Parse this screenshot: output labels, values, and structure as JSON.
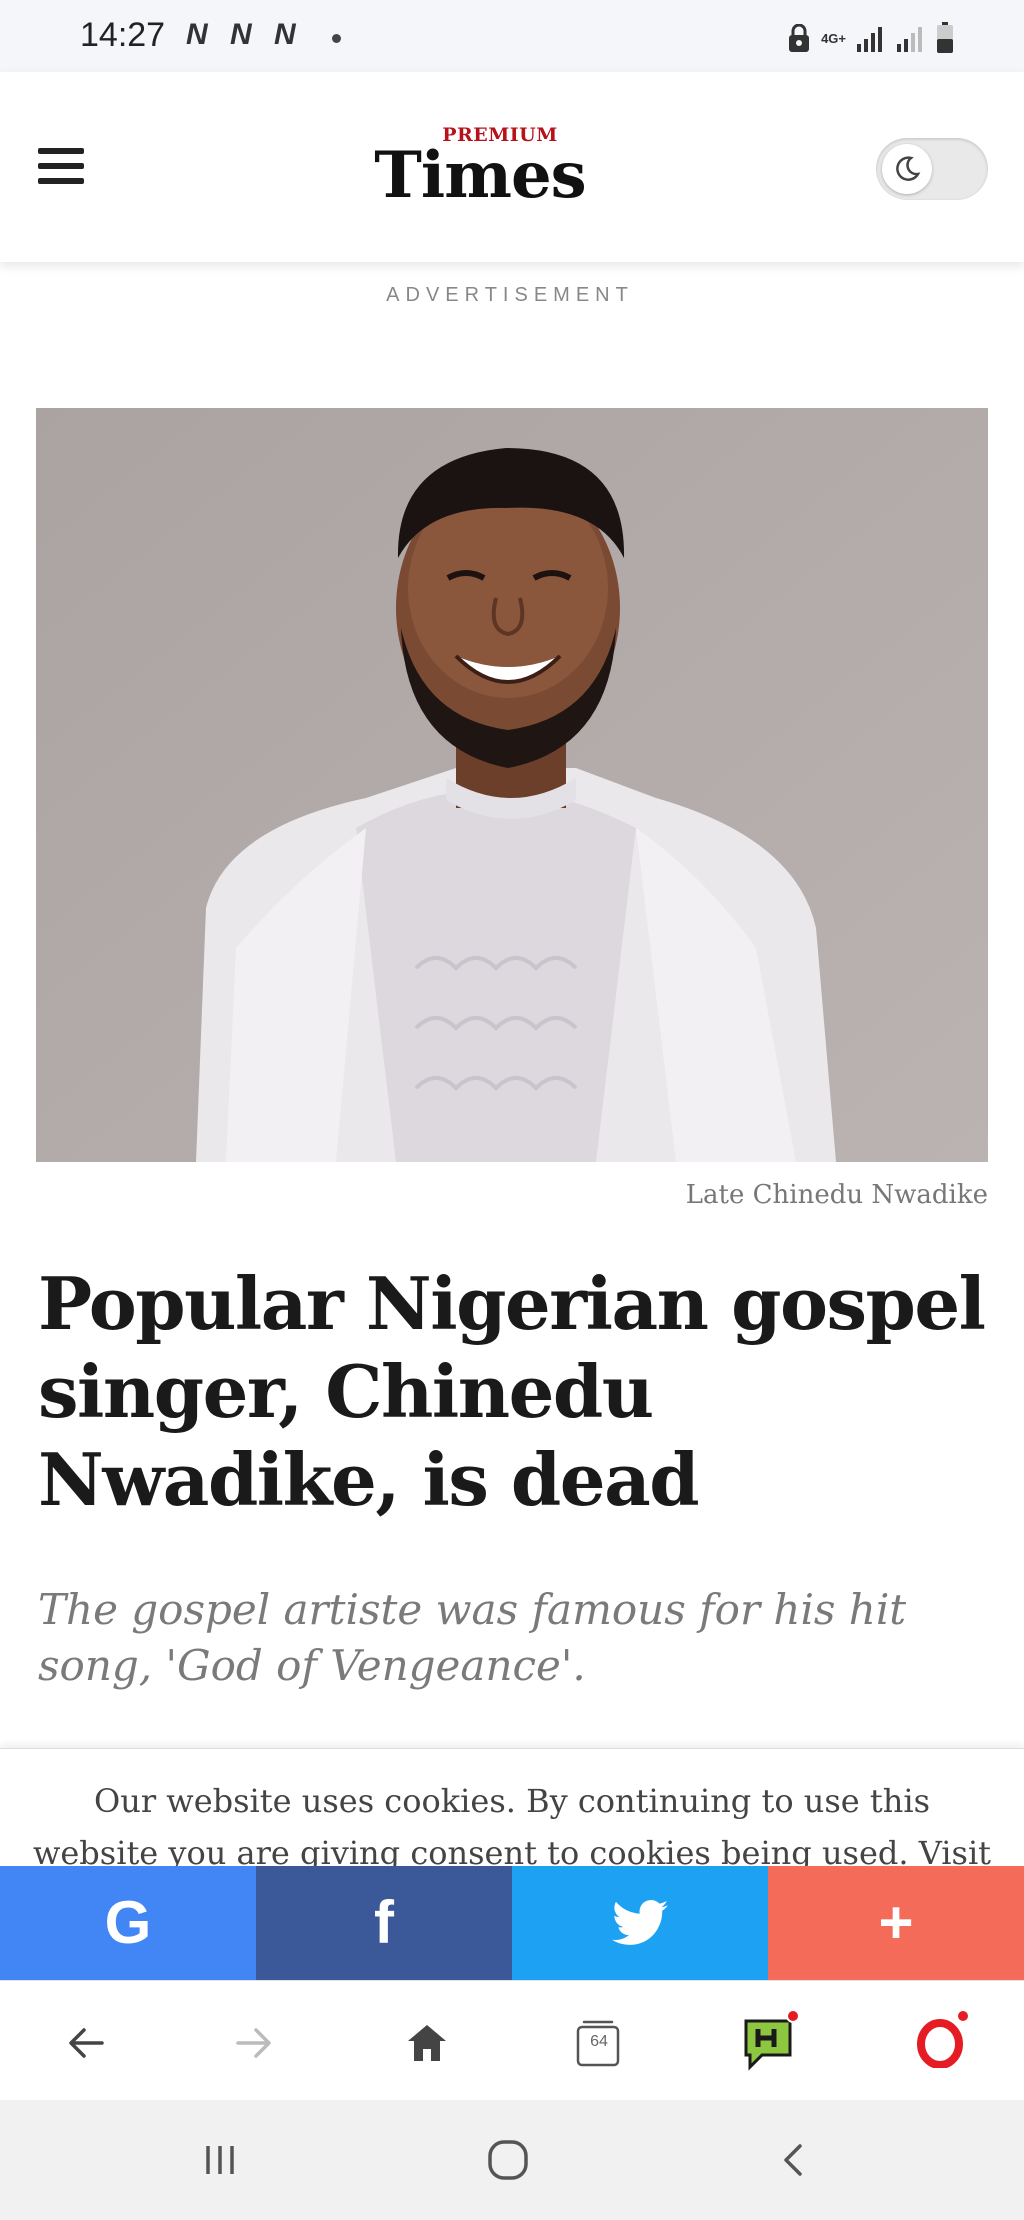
{
  "status_bar": {
    "time": "14:27",
    "carrier_icons": [
      "N",
      "N",
      "N"
    ],
    "network_label": "4G+"
  },
  "header": {
    "logo_premium": "PREMIUM",
    "logo_times": "Times",
    "menu_icon": "hamburger-menu-icon",
    "theme_toggle_icon": "moon-icon",
    "theme_toggle_on": false
  },
  "advertisement_label": "ADVERTISEMENT",
  "article": {
    "image_caption": "Late Chinedu Nwadike",
    "headline": "Popular Nigerian gospel singer, Chinedu Nwadike, is dead",
    "subtitle": "The gospel artiste was famous for his hit song, 'God of Vengeance'."
  },
  "cookie_notice": {
    "text": "Our website uses cookies. By continuing to use this website you are giving consent to cookies being used. Visit"
  },
  "share_bar": {
    "buttons": [
      {
        "label": "G",
        "icon": "google-icon",
        "color": "#4285f4"
      },
      {
        "label": "f",
        "icon": "facebook-icon",
        "color": "#3b5998"
      },
      {
        "label": "",
        "icon": "twitter-icon",
        "color": "#1da1f2"
      },
      {
        "label": "+",
        "icon": "plus-icon",
        "color": "#f56b5a"
      }
    ]
  },
  "browser_bar": {
    "tab_count": "64",
    "buttons": [
      "back-arrow-icon",
      "forward-arrow-icon",
      "home-icon",
      "tabs-icon",
      "news-hub-icon",
      "opera-icon"
    ]
  },
  "nav_bar": {
    "buttons": [
      "recent-apps-icon",
      "home-circle-icon",
      "back-chevron-icon"
    ]
  },
  "colors": {
    "brand_red": "#b5121b",
    "google": "#4285f4",
    "facebook": "#3b5998",
    "twitter": "#1da1f2",
    "more": "#f56b5a"
  }
}
